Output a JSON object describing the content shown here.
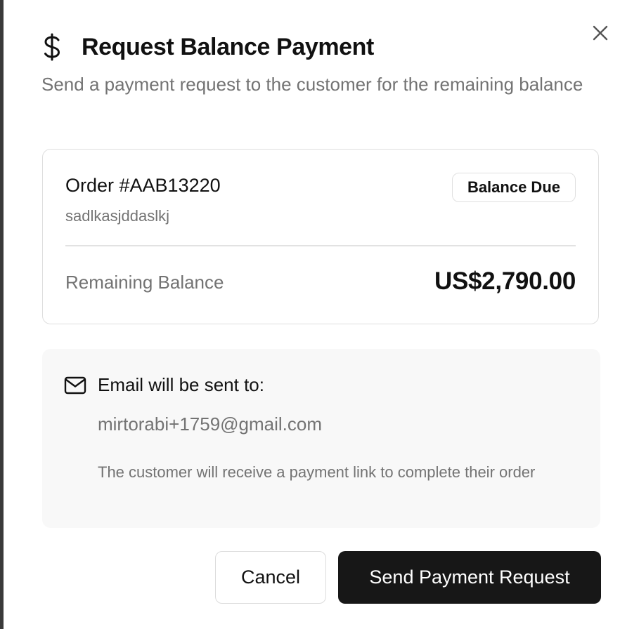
{
  "dialog": {
    "title": "Request Balance Payment",
    "subtitle": "Send a payment request to the customer for the remaining balance",
    "title_icon": "dollar-icon",
    "close_icon": "close-icon"
  },
  "order": {
    "number": "Order #AAB13220",
    "subtext": "sadlkasjddaslkj",
    "status_badge": "Balance Due",
    "balance_label": "Remaining Balance",
    "balance_value": "US$2,790.00"
  },
  "email": {
    "icon": "mail-icon",
    "heading": "Email will be sent to:",
    "address": "mirtorabi+1759@gmail.com",
    "note": "The customer will receive a payment link to complete their order"
  },
  "actions": {
    "cancel_label": "Cancel",
    "send_label": "Send Payment Request"
  },
  "colors": {
    "primary_button": "#171717",
    "muted_text": "#737373",
    "panel_background": "#f8f8f8",
    "border": "#dedede"
  }
}
